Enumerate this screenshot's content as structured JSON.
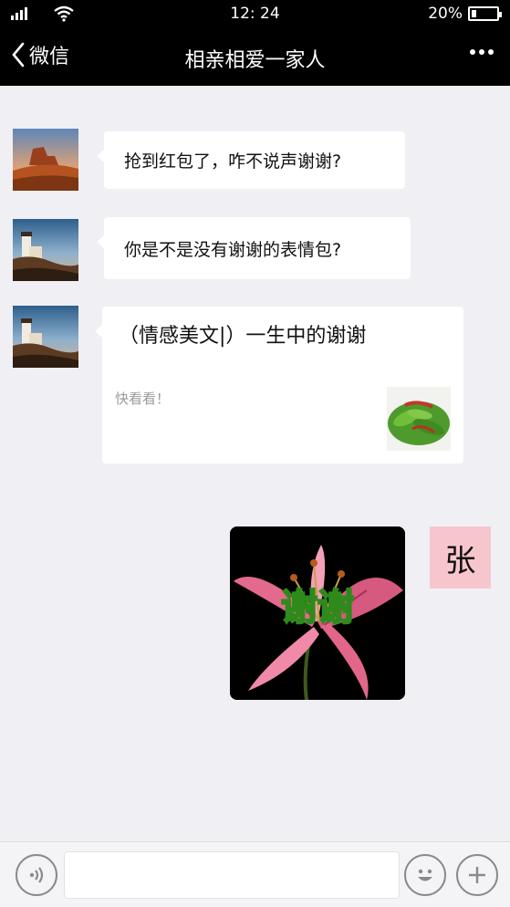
{
  "status_bar": {
    "time": "12: 24",
    "battery_text": "20%",
    "battery_level": 0.2
  },
  "nav": {
    "back_label": "微信",
    "title": "相亲相爱一家人"
  },
  "messages": [
    {
      "text": "抢到红包了，咋不说声谢谢?"
    },
    {
      "text": "你是不是没有谢谢的表情包?"
    }
  ],
  "link_card": {
    "title": "（情感美文|）一生中的谢谢",
    "description": "快看看！"
  },
  "sticker": {
    "caption": "谢谢"
  },
  "self_avatar": {
    "text": "张"
  },
  "input_bar": {
    "placeholder": ""
  },
  "colors": {
    "nav_bg": "#000000",
    "chat_bg": "#efeff4",
    "self_avatar_bg": "#f7c6cc"
  }
}
